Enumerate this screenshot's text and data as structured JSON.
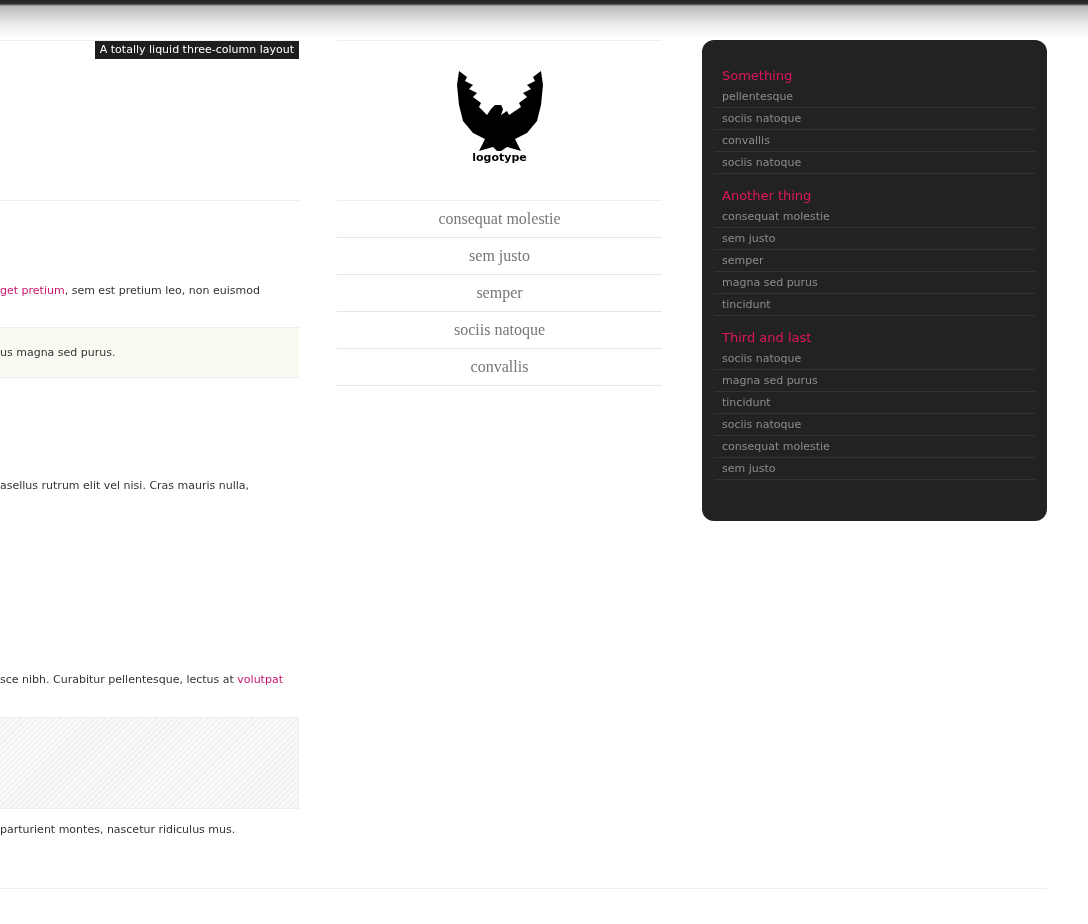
{
  "header": {
    "tagline": "A totally liquid three-column layout"
  },
  "content": {
    "blocks": [
      {
        "kind": "paragraph",
        "segments": [
          {
            "text": "get pretium",
            "link": true
          },
          {
            "text": ", sem est pretium leo, non euismod",
            "link": false
          }
        ]
      },
      {
        "kind": "callout",
        "segments": [
          {
            "text": "us magna sed purus.",
            "link": false
          }
        ]
      },
      {
        "kind": "paragraph",
        "segments": [
          {
            "text": "asellus rutrum elit vel nisi. Cras mauris nulla,",
            "link": false
          }
        ]
      },
      {
        "kind": "paragraph",
        "segments": [
          {
            "text": "sce nibh. Curabitur pellentesque, lectus at ",
            "link": false
          },
          {
            "text": "volutpat",
            "link": true
          }
        ]
      },
      {
        "kind": "pattern"
      },
      {
        "kind": "paragraph",
        "segments": [
          {
            "text": "parturient montes, nascetur ridiculus mus.",
            "link": false
          }
        ]
      }
    ]
  },
  "logo": {
    "text": "logotype"
  },
  "nav": {
    "items": [
      "consequat molestie",
      "sem justo",
      "semper",
      "sociis natoque",
      "convallis"
    ]
  },
  "sidebar": {
    "sections": [
      {
        "title": "Something",
        "items": [
          "pellentesque",
          "sociis natoque",
          "convallis",
          "sociis natoque"
        ]
      },
      {
        "title": "Another thing",
        "items": [
          "consequat molestie",
          "sem justo",
          "semper",
          "magna sed purus",
          "tincidunt"
        ]
      },
      {
        "title": "Third and last",
        "items": [
          "sociis natoque",
          "magna sed purus",
          "tincidunt",
          "sociis natoque",
          "consequat molestie",
          "sem justo"
        ]
      }
    ]
  }
}
